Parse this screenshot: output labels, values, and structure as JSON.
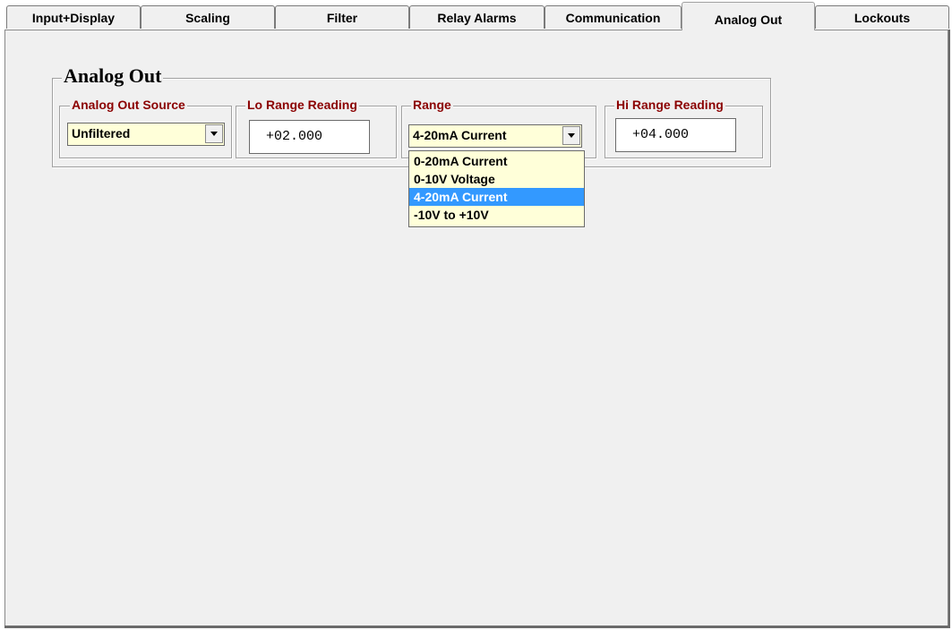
{
  "tabs": [
    {
      "label": "Input+Display",
      "active": false
    },
    {
      "label": "Scaling",
      "active": false
    },
    {
      "label": "Filter",
      "active": false
    },
    {
      "label": "Relay Alarms",
      "active": false
    },
    {
      "label": "Communication",
      "active": false
    },
    {
      "label": "Analog Out",
      "active": true
    },
    {
      "label": "Lockouts",
      "active": false
    }
  ],
  "group_title": "Analog Out",
  "source": {
    "legend": "Analog Out Source",
    "value": "Unfiltered"
  },
  "lo_range": {
    "legend": "Lo Range Reading",
    "value": "+02.000"
  },
  "range": {
    "legend": "Range",
    "value": "4-20mA Current",
    "options": [
      "0-20mA Current",
      "0-10V Voltage",
      "4-20mA Current",
      "-10V to +10V"
    ],
    "highlighted_index": 2
  },
  "hi_range": {
    "legend": "Hi Range Reading",
    "value": "+04.000"
  },
  "colors": {
    "legend_text": "#8b0000",
    "combo_bg": "#ffffd9",
    "selection": "#3399ff"
  }
}
